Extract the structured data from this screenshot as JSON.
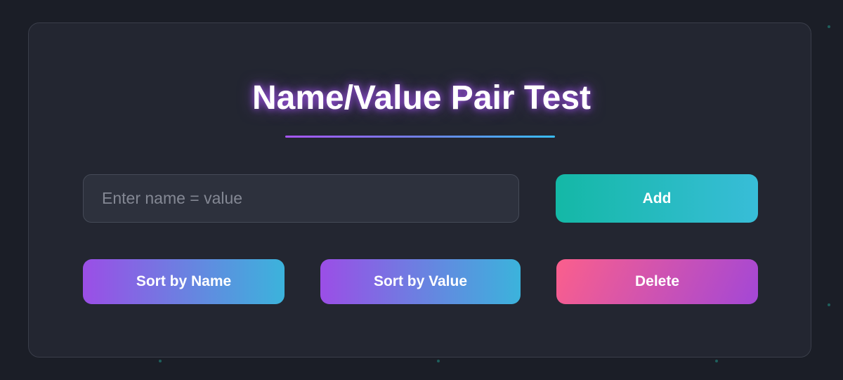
{
  "header": {
    "title": "Name/Value Pair Test"
  },
  "entry": {
    "placeholder": "Enter name = value",
    "value": ""
  },
  "actions": {
    "add_label": "Add",
    "sort_by_name_label": "Sort by Name",
    "sort_by_value_label": "Sort by Value",
    "delete_label": "Delete"
  },
  "colors": {
    "background": "#1b1e27",
    "card": "#232631",
    "title_glow": "#a855f7",
    "add_gradient": [
      "#14b8a6",
      "#38bdd8"
    ],
    "sort_gradient": [
      "#9b4ee6",
      "#3bb3dc"
    ],
    "delete_gradient": [
      "#fb5f8c",
      "#a347d6"
    ]
  }
}
